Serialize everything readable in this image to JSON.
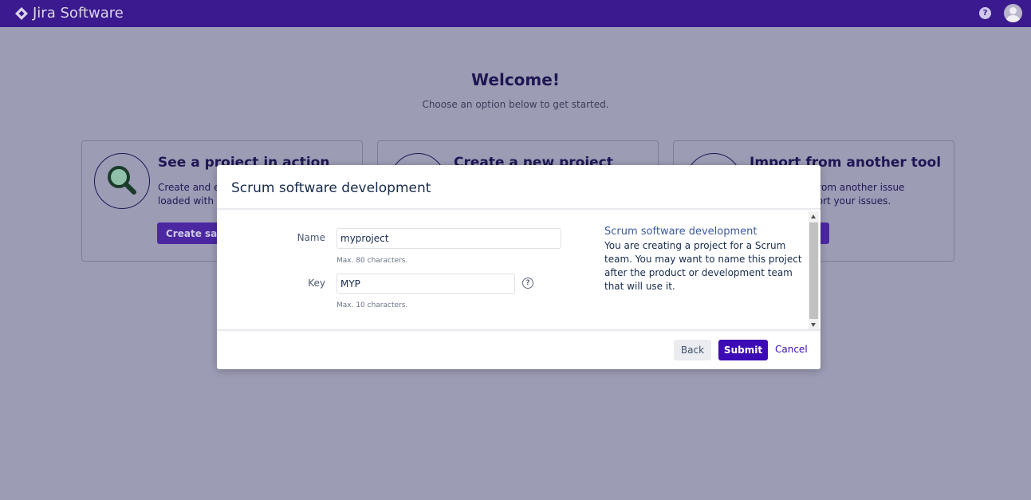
{
  "header": {
    "brand": "Jira Software",
    "help_icon": "help-icon",
    "avatar_icon": "user-avatar-icon"
  },
  "welcome": {
    "title": "Welcome!",
    "subtitle": "Choose an option below to get started."
  },
  "cards": [
    {
      "title": "See a project in action",
      "text_line1": "Create and explore a sample project",
      "text_line2": "loaded with sample data.",
      "button": "Create sample data",
      "icon": "magnifier-icon"
    },
    {
      "title": "Create a new project",
      "text_line1": "",
      "text_line2": "",
      "button": "",
      "icon": "new-project-icon"
    },
    {
      "title": "Import from another tool",
      "text_line1": "Bring in data from another issue",
      "text_line2": "tracker to import your issues.",
      "button": "",
      "icon": "import-icon"
    }
  ],
  "modal": {
    "title": "Scrum software development",
    "name_label": "Name",
    "name_value": "myproject",
    "name_hint": "Max. 80 characters.",
    "key_label": "Key",
    "key_value": "MYP",
    "key_hint": "Max. 10 characters.",
    "key_help_icon": "question-circle-icon",
    "desc_title": "Scrum software development",
    "desc_text": "You are creating a project for a Scrum team. You may want to name this project after the product or development team that will use it.",
    "back_label": "Back",
    "submit_label": "Submit",
    "cancel_label": "Cancel"
  },
  "colors": {
    "topbar": "#3a1a8e",
    "primary_button": "#3d0bb5",
    "overlay": "#9c9cb5"
  }
}
